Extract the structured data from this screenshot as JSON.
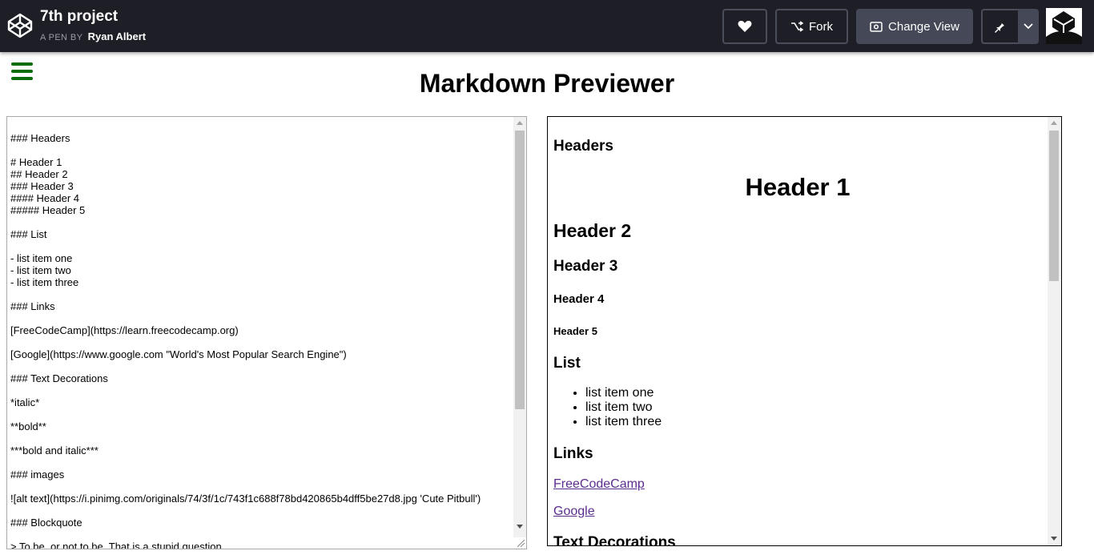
{
  "header": {
    "title": "7th project",
    "byline_prefix": "A PEN BY",
    "author": "Ryan Albert",
    "heart_icon": "heart-icon",
    "fork_label": "Fork",
    "change_view_label": "Change View",
    "pin_icon": "pin-icon"
  },
  "page": {
    "heading": "Markdown Previewer"
  },
  "editor": {
    "lines": [
      "",
      "### Headers",
      "",
      "# Header 1",
      "## Header 2",
      "### Header 3",
      "#### Header 4",
      "##### Header 5",
      "",
      "### List",
      "",
      "- list item one",
      "- list item two",
      "- list item three",
      "",
      "### Links",
      "",
      "[FreeCodeCamp](https://learn.freecodecamp.org)",
      "",
      "[Google](https://www.google.com \"World's Most Popular Search Engine\")",
      "",
      "### Text Decorations",
      "",
      "*italic*",
      "",
      "**bold**",
      "",
      "***bold and italic***",
      "",
      "### images",
      "",
      "![alt text](https://i.pinimg.com/originals/74/3f/1c/743f1c688f78bd420865b4dff5be27d8.jpg 'Cute Pitbull')",
      "",
      "### Blockquote",
      "",
      "> To be, or not to be. That is a stupid question."
    ]
  },
  "preview": {
    "h3_headers": "Headers",
    "h1": "Header 1",
    "h2": "Header 2",
    "h3": "Header 3",
    "h4": "Header 4",
    "h5": "Header 5",
    "h3_list": "List",
    "list_items": [
      "list item one",
      "list item two",
      "list item three"
    ],
    "h3_links": "Links",
    "link_freecodecamp": "FreeCodeCamp",
    "link_google": "Google",
    "h3_text_decorations": "Text Decorations"
  },
  "colors": {
    "topbar": "#1e1f26",
    "menu_icon": "#0a6c0a",
    "visited_link": "#5b2d8e"
  }
}
